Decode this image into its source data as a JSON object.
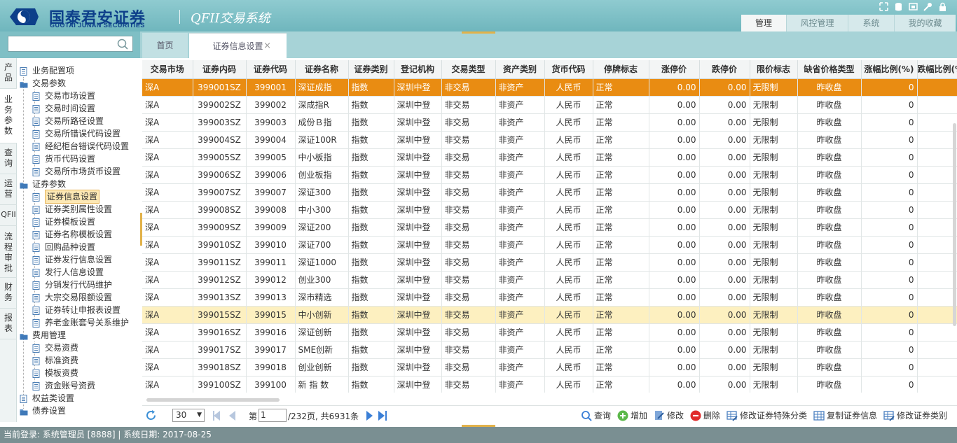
{
  "brand": {
    "name_cn": "国泰君安证券",
    "name_en": "GUOTAI JUNAN SECURITIES",
    "system_title": "QFII交易系统"
  },
  "top_nav": [
    {
      "label": "管理",
      "active": true
    },
    {
      "label": "风控管理",
      "active": false
    },
    {
      "label": "系统",
      "active": false
    },
    {
      "label": "我的收藏",
      "active": false
    }
  ],
  "search": {
    "placeholder": ""
  },
  "page_tabs": {
    "home": "首页",
    "current": "证券信息设置",
    "close": "×"
  },
  "rail": [
    {
      "label": "产品"
    },
    {
      "label": "业务参数"
    },
    {
      "label": "查询"
    },
    {
      "label": "运营"
    },
    {
      "label": "QFII"
    },
    {
      "label": "流程审批"
    },
    {
      "label": "财务"
    },
    {
      "label": "报表"
    }
  ],
  "tree": {
    "n0": "业务配置项",
    "n1": "交易参数",
    "n2": "交易市场设置",
    "n3": "交易时间设置",
    "n4": "交易所路径设置",
    "n5": "交易所错误代码设置",
    "n6": "经纪柜台错误代码设置",
    "n7": "货币代码设置",
    "n8": "交易所市场货币设置",
    "n9": "证券参数",
    "n10": "证券信息设置",
    "n11": "证券类别属性设置",
    "n12": "证券模板设置",
    "n13": "证券名称模板设置",
    "n14": "回购品种设置",
    "n15": "证券发行信息设置",
    "n16": "发行人信息设置",
    "n17": "分销发行代码维护",
    "n18": "大宗交易限额设置",
    "n19": "证券转让申报表设置",
    "n20": "养老金账套号关系维护",
    "n21": "费用管理",
    "n22": "交易资费",
    "n23": "标准资费",
    "n24": "模板资费",
    "n25": "资金账号资费",
    "n26": "权益类设置",
    "n27": "债券设置"
  },
  "table": {
    "headers": [
      "交易市场",
      "证券内码",
      "证券代码",
      "证券名称",
      "证券类别",
      "登记机构",
      "交易类型",
      "资产类别",
      "货币代码",
      "停牌标志",
      "涨停价",
      "跌停价",
      "限价标志",
      "缺省价格类型",
      "涨幅比例(%)",
      "跌幅比例(%)"
    ],
    "rows": [
      [
        "深A",
        "399001SZ",
        "399001",
        "深证成指",
        "指数",
        "深圳中登",
        "非交易",
        "非资产",
        "人民币",
        "正常",
        "0.00",
        "0.00",
        "无限制",
        "昨收盘",
        "0",
        ""
      ],
      [
        "深A",
        "399002SZ",
        "399002",
        "深成指R",
        "指数",
        "深圳中登",
        "非交易",
        "非资产",
        "人民币",
        "正常",
        "0.00",
        "0.00",
        "无限制",
        "昨收盘",
        "0",
        ""
      ],
      [
        "深A",
        "399003SZ",
        "399003",
        "成份Ｂ指",
        "指数",
        "深圳中登",
        "非交易",
        "非资产",
        "人民币",
        "正常",
        "0.00",
        "0.00",
        "无限制",
        "昨收盘",
        "0",
        ""
      ],
      [
        "深A",
        "399004SZ",
        "399004",
        "深证100R",
        "指数",
        "深圳中登",
        "非交易",
        "非资产",
        "人民币",
        "正常",
        "0.00",
        "0.00",
        "无限制",
        "昨收盘",
        "0",
        ""
      ],
      [
        "深A",
        "399005SZ",
        "399005",
        "中小板指",
        "指数",
        "深圳中登",
        "非交易",
        "非资产",
        "人民币",
        "正常",
        "0.00",
        "0.00",
        "无限制",
        "昨收盘",
        "0",
        ""
      ],
      [
        "深A",
        "399006SZ",
        "399006",
        "创业板指",
        "指数",
        "深圳中登",
        "非交易",
        "非资产",
        "人民币",
        "正常",
        "0.00",
        "0.00",
        "无限制",
        "昨收盘",
        "0",
        ""
      ],
      [
        "深A",
        "399007SZ",
        "399007",
        "深证300",
        "指数",
        "深圳中登",
        "非交易",
        "非资产",
        "人民币",
        "正常",
        "0.00",
        "0.00",
        "无限制",
        "昨收盘",
        "0",
        ""
      ],
      [
        "深A",
        "399008SZ",
        "399008",
        "中小300",
        "指数",
        "深圳中登",
        "非交易",
        "非资产",
        "人民币",
        "正常",
        "0.00",
        "0.00",
        "无限制",
        "昨收盘",
        "0",
        ""
      ],
      [
        "深A",
        "399009SZ",
        "399009",
        "深证200",
        "指数",
        "深圳中登",
        "非交易",
        "非资产",
        "人民币",
        "正常",
        "0.00",
        "0.00",
        "无限制",
        "昨收盘",
        "0",
        ""
      ],
      [
        "深A",
        "399010SZ",
        "399010",
        "深证700",
        "指数",
        "深圳中登",
        "非交易",
        "非资产",
        "人民币",
        "正常",
        "0.00",
        "0.00",
        "无限制",
        "昨收盘",
        "0",
        ""
      ],
      [
        "深A",
        "399011SZ",
        "399011",
        "深证1000",
        "指数",
        "深圳中登",
        "非交易",
        "非资产",
        "人民币",
        "正常",
        "0.00",
        "0.00",
        "无限制",
        "昨收盘",
        "0",
        ""
      ],
      [
        "深A",
        "399012SZ",
        "399012",
        "创业300",
        "指数",
        "深圳中登",
        "非交易",
        "非资产",
        "人民币",
        "正常",
        "0.00",
        "0.00",
        "无限制",
        "昨收盘",
        "0",
        ""
      ],
      [
        "深A",
        "399013SZ",
        "399013",
        "深市精选",
        "指数",
        "深圳中登",
        "非交易",
        "非资产",
        "人民币",
        "正常",
        "0.00",
        "0.00",
        "无限制",
        "昨收盘",
        "0",
        ""
      ],
      [
        "深A",
        "399015SZ",
        "399015",
        "中小创新",
        "指数",
        "深圳中登",
        "非交易",
        "非资产",
        "人民币",
        "正常",
        "0.00",
        "0.00",
        "无限制",
        "昨收盘",
        "0",
        ""
      ],
      [
        "深A",
        "399016SZ",
        "399016",
        "深证创新",
        "指数",
        "深圳中登",
        "非交易",
        "非资产",
        "人民币",
        "正常",
        "0.00",
        "0.00",
        "无限制",
        "昨收盘",
        "0",
        ""
      ],
      [
        "深A",
        "399017SZ",
        "399017",
        "SME创新",
        "指数",
        "深圳中登",
        "非交易",
        "非资产",
        "人民币",
        "正常",
        "0.00",
        "0.00",
        "无限制",
        "昨收盘",
        "0",
        ""
      ],
      [
        "深A",
        "399018SZ",
        "399018",
        "创业创新",
        "指数",
        "深圳中登",
        "非交易",
        "非资产",
        "人民币",
        "正常",
        "0.00",
        "0.00",
        "无限制",
        "昨收盘",
        "0",
        ""
      ],
      [
        "深A",
        "399100SZ",
        "399100",
        "新 指 数",
        "指数",
        "深圳中登",
        "非交易",
        "非资产",
        "人民币",
        "正常",
        "0.00",
        "0.00",
        "无限制",
        "昨收盘",
        "0",
        ""
      ]
    ]
  },
  "pager": {
    "page_size": "30",
    "page_prefix": "第",
    "page_value": "1",
    "page_suffix": "/232页, 共6931条",
    "actions": {
      "query": "查询",
      "add": "增加",
      "edit": "修改",
      "delete": "删除",
      "edit_special": "修改证券特殊分类",
      "copy": "复制证券信息",
      "edit_type": "修改证券类别"
    }
  },
  "status": {
    "text": "当前登录: 系统管理员 [8888] | 系统日期: 2017-08-25"
  },
  "colors": {
    "selected_row": "#e98c12",
    "highlight_row": "#fdf0c0",
    "header_teal": "#6fb6bd",
    "brand_blue": "#0d3f8a"
  }
}
